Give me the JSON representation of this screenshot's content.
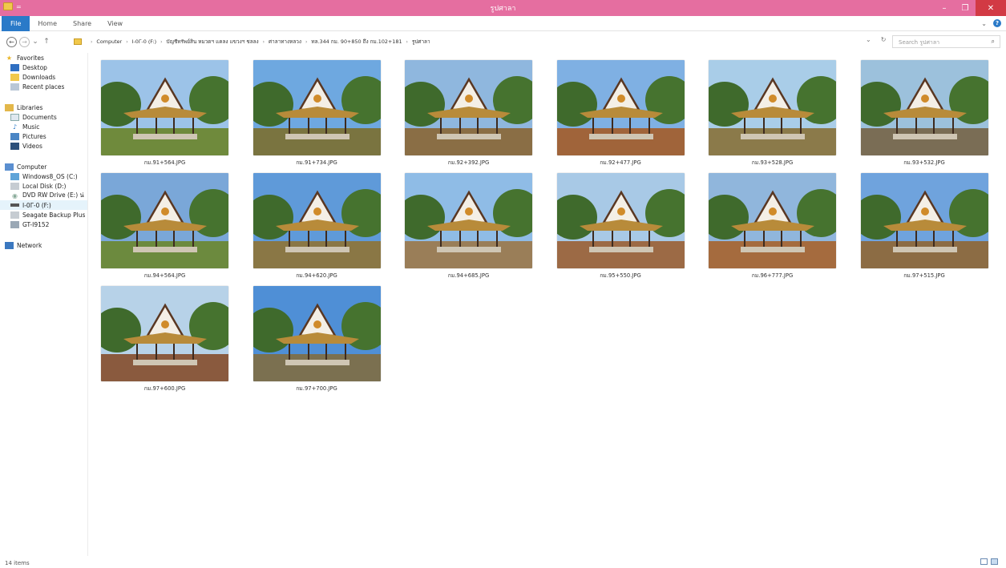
{
  "window": {
    "title": "รูปศาลา",
    "minimize": "–",
    "maximize": "❐",
    "close": "✕"
  },
  "ribbon": {
    "tabs": [
      "File",
      "Home",
      "Share",
      "View"
    ],
    "expand": "⌄"
  },
  "nav": {
    "back": "←",
    "forward": "→",
    "recent": "⌄",
    "up": "↑"
  },
  "address": {
    "crumbs": [
      "Computer",
      "I-0Γ-0 (F:)",
      "บัญชีทรัพย์สิน หมวดฯ แคลง แขวงฯ ชลลง",
      "ศาลาทางหลวง",
      "ทล.344 กม. 90+850 ถึง กม.102+181",
      "รูปศาลา"
    ],
    "dropdown": "⌄",
    "refresh": "↻"
  },
  "search": {
    "placeholder": "Search รูปศาลา"
  },
  "navpane": {
    "favorites": {
      "label": "Favorites",
      "items": [
        "Desktop",
        "Downloads",
        "Recent places"
      ]
    },
    "libraries": {
      "label": "Libraries",
      "items": [
        "Documents",
        "Music",
        "Pictures",
        "Videos"
      ]
    },
    "computer": {
      "label": "Computer",
      "items": [
        "Windows8_OS (C:)",
        "Local Disk (D:)",
        "DVD RW Drive (E:) น่",
        "I-0Γ-0 (F:)",
        "Seagate Backup Plus",
        "GT-I9152"
      ]
    },
    "network": {
      "label": "Network"
    }
  },
  "files": [
    {
      "name": "กม.91+564.JPG"
    },
    {
      "name": "กม.91+734.JPG"
    },
    {
      "name": "กม.92+392.JPG"
    },
    {
      "name": "กม.92+477.JPG"
    },
    {
      "name": "กม.93+528.JPG"
    },
    {
      "name": "กม.93+532.JPG"
    },
    {
      "name": "กม.94+564.JPG"
    },
    {
      "name": "กม.94+620.JPG"
    },
    {
      "name": "กม.94+685.JPG"
    },
    {
      "name": "กม.95+550.JPG"
    },
    {
      "name": "กม.96+777.JPG"
    },
    {
      "name": "กม.97+515.JPG"
    },
    {
      "name": "กม.97+600.JPG"
    },
    {
      "name": "กม.97+700.JPG"
    }
  ],
  "status": {
    "count": "14 items"
  },
  "colors": {
    "titlebar": "#e56ea0",
    "file_tab": "#2a7ac8",
    "close": "#d23a44"
  }
}
